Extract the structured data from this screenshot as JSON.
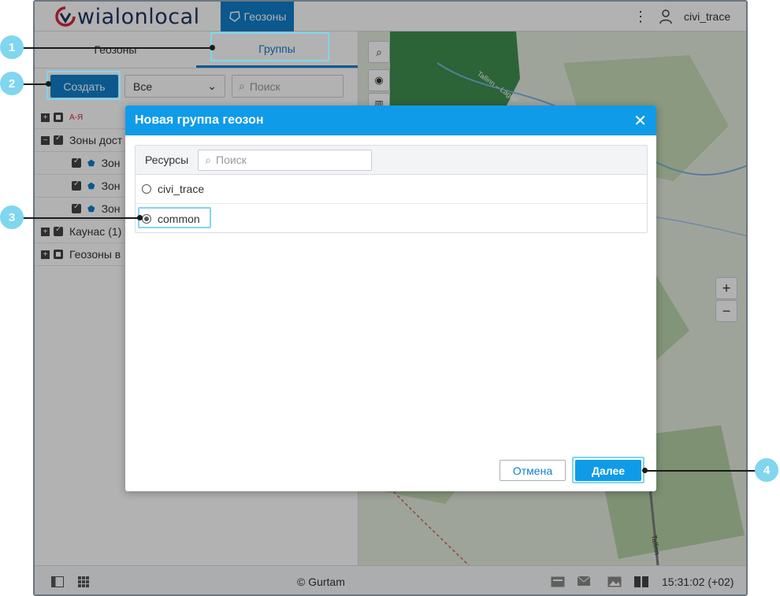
{
  "header": {
    "logo_text": "wialonlocal",
    "geo_tab_label": "Геозоны",
    "username": "civi_trace"
  },
  "left_panel": {
    "tabs": [
      {
        "label": "Геозоны",
        "active": false
      },
      {
        "label": "Группы",
        "active": true
      }
    ],
    "create_label": "Создать",
    "filter_value": "Все",
    "search_placeholder": "Поиск",
    "sort_icon": "А-Я",
    "tree": [
      {
        "label": "Зоны дост",
        "type": "group"
      },
      {
        "label": "Зон",
        "type": "child"
      },
      {
        "label": "Зон",
        "type": "child"
      },
      {
        "label": "Зон",
        "type": "child"
      },
      {
        "label": "Каунас (1)",
        "type": "group"
      },
      {
        "label": "Геозоны в",
        "type": "group"
      }
    ]
  },
  "map": {
    "zoom_in": "+",
    "zoom_out": "−",
    "road_label_1": "Tallinn – Lagna",
    "road_label_2": "Tallinn"
  },
  "footer": {
    "copyright": "© Gurtam",
    "clock": "15:31:02 (+02)"
  },
  "dialog": {
    "title": "Новая группа геозон",
    "resources_label": "Ресурсы",
    "search_placeholder": "Поиск",
    "options": [
      {
        "label": "civi_trace",
        "selected": false
      },
      {
        "label": "common",
        "selected": true
      }
    ],
    "cancel_label": "Отмена",
    "next_label": "Далее"
  },
  "callouts": [
    "1",
    "2",
    "3",
    "4"
  ],
  "colors": {
    "accent": "#0f7fcc",
    "dialog_header": "#0f9be8",
    "highlight": "#7fd6ee"
  }
}
